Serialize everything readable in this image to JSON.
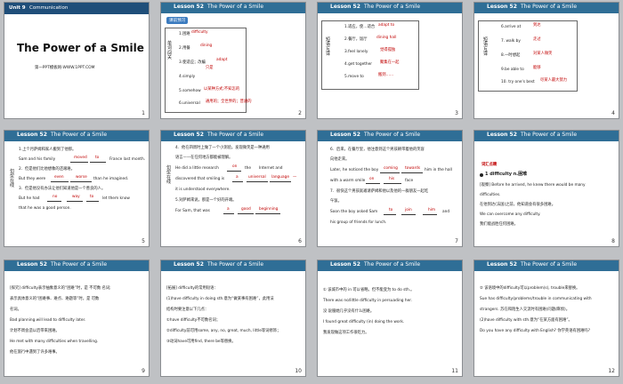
{
  "common": {
    "lesson": "Lesson 52",
    "topic": "The Power of a Smile"
  },
  "slides": [
    {
      "unit": "Unit 9",
      "unit_topic": "Communication",
      "title": "The Power of a Smile",
      "sub": "第一PPT模板网-WWW.1PPT.COM",
      "num": "1"
    },
    {
      "badge": "课前预习",
      "vert": "单词闯关",
      "items": [
        "1.困难",
        "2.用餐",
        "3.使适应；改编",
        "4.simply",
        "5.somehow",
        "6.universal"
      ],
      "answers": [
        "difficulty",
        "dining",
        "adapt",
        "只是",
        "以某种方式;不知怎的",
        "通用的；全世界的；普遍的"
      ],
      "answer_extra": "",
      "num": "2"
    },
    {
      "vert": "短语互译",
      "items": [
        "1.适应，使…适合",
        "2.餐厅，饭厅",
        "3.feel lonely",
        "4.get together",
        "5.move to"
      ],
      "answers": [
        "adapt to",
        "dining hall",
        "觉得孤独",
        "聚集在一起",
        "搬到……"
      ],
      "num": "3"
    },
    {
      "vert": "短语互译",
      "items": [
        "6.arrive at",
        "7. walk by",
        "8.一时想起",
        "9.be able to",
        "10. try one's best"
      ],
      "answers": [
        "到达",
        "走过",
        "对某人微笑",
        "能够",
        "尽某人最大努力"
      ],
      "num": "4"
    },
    {
      "vert": "句型在线",
      "lines": [
        "1.上个月萨姆和家人搬到了他那。",
        "Sam and his family",
        "France last month.",
        "2．但是他们比他想象的还艰难。",
        "But they were",
        "than he imagined.",
        "3．但是他没有办法让他们知道他是一个善良的人。",
        "But he had",
        "let them know",
        "that he was a good person."
      ],
      "answers": [
        "moved",
        "to",
        "even",
        "worse",
        "no",
        "way",
        "to"
      ],
      "num": "5"
    },
    {
      "vert": "句型在线",
      "lines": [
        "4．他在四周时上做了一个小测验。发现微笑是一种通用",
        "语言——在任何地方都能被理解。",
        "He did a little research",
        "the",
        "Internet and",
        "discovered that smiling is",
        "a",
        "universal",
        "language",
        "it is understood everywhere.",
        "5.对萨姆来说，那是一个好的开端。",
        "For Sam, that was",
        "a",
        "good",
        "beginning"
      ],
      "answers": [
        "on",
        "—"
      ],
      "num": "6"
    },
    {
      "lines": [
        "6．后来，在餐厅里，他注意到这个男孩朝带着他的笑容",
        "向他走来。",
        "Later, he noticed the boy",
        "coming",
        "towards",
        "him in the hall",
        "with a warm smile",
        "on",
        "his",
        "face",
        "7．很快这个男孩就邀请萨姆和他以及他的一群朋友一起吃",
        "午饭。",
        "Soon the boy asked Sam",
        "to",
        "join",
        "him",
        "and",
        "his group of friends for lunch."
      ],
      "num": "7"
    },
    {
      "tag": "词汇点睛",
      "title": "1 difficulty n.困难",
      "lines": [
        "[观察] Before he arrived, he knew there would be many",
        "difficulties.",
        "在他到达(法国)之前，他知道会有很多困难。",
        "We can overcome any difficulty.",
        "我们能战胜任何困难。"
      ],
      "num": "8"
    },
    {
      "lines": [
        "[探究] difficulty表示抽象意义的“困难”时，是 不可数 名词;",
        "表示具体意义的“困难事、难点、难题等”时，是 可数",
        "名词。",
        "Bad planning will lead to difficulty later.",
        "计划不周会造以后带来困难。",
        "He met with many difficulties when travelling.",
        "他在旅行中遇到了许多难事。"
      ],
      "num": "9"
    },
    {
      "lines": [
        "[拓展] difficulty的常用短语：",
        "(1)have difficulty in doing sth.意为“做某事有困难”，此用法",
        "结构时要注意以下几点：",
        "①have difficulty不可数名词；",
        "②difficulty前可用some, any, no, great, much, little等词修饰；",
        "③动词have可用find, there be等替换。"
      ],
      "num": "10"
    },
    {
      "lines": [
        "① 该城市中的 in 可以省略。但不能变为 to do sth.。",
        "There was no/little difficulty in persuading her.",
        "没 说服她几乎没有什么困难。",
        "I found great difficulty (in) doing the work.",
        "我发现做这项工作很吃力。"
      ],
      "num": "11"
    },
    {
      "lines": [
        "② 该语境中的difficulty可以problem(s), trouble来替换。",
        "Sue has difficulty/problems/trouble in communicating with",
        "strangers. 苏在和陌生人交流时有困难(问题/麻烦)。",
        "(2)have difficulty with sth.意为“在某方面有困难”。",
        "Do you have any difficulty with English? 你学英语有困难吗?"
      ],
      "num": "12"
    }
  ]
}
